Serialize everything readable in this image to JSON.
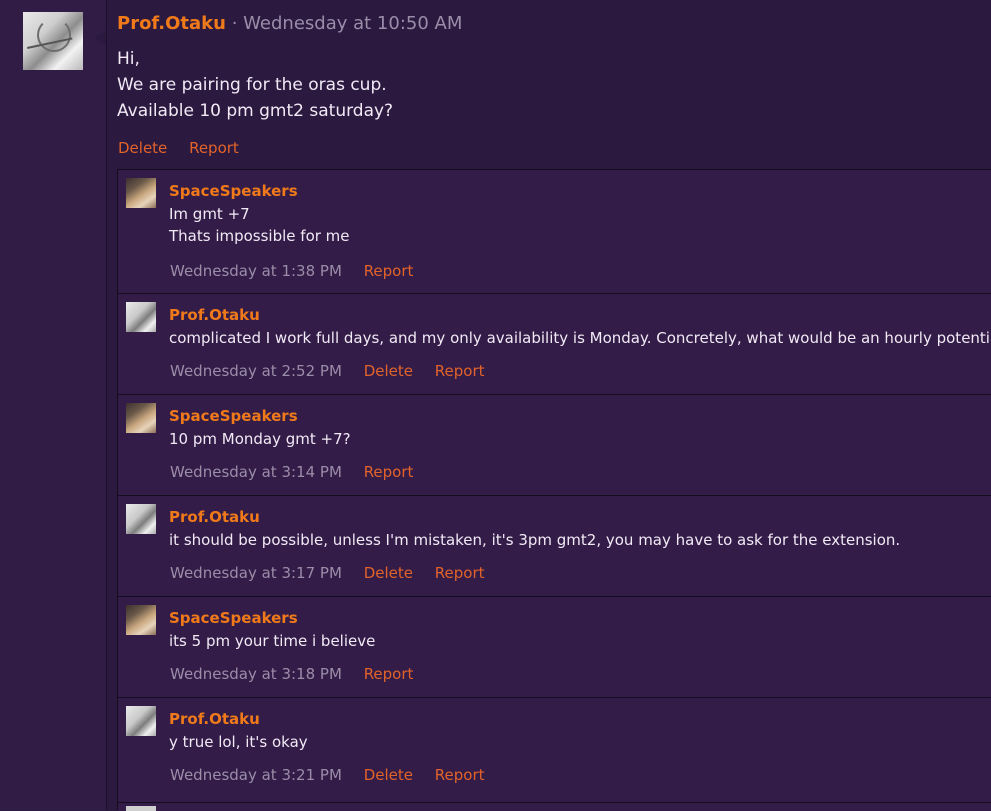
{
  "post": {
    "author": "Prof.Otaku",
    "separator": "·",
    "timestamp": "Wednesday at 10:50 AM",
    "lines": [
      "Hi,",
      "We are pairing for the oras cup.",
      "Available 10 pm gmt2 saturday?"
    ],
    "actions": {
      "delete": "Delete",
      "report": "Report"
    }
  },
  "comments": [
    {
      "author": "SpaceSpeakers",
      "avatar": "spacespeakers-avatar",
      "lines": [
        "Im gmt +7",
        "Thats impossible for me"
      ],
      "time": "Wednesday at 1:38 PM",
      "report": "Report"
    },
    {
      "author": "Prof.Otaku",
      "avatar": "prof-otaku-avatar",
      "lines": [
        "complicated I work full days, and my only availability is Monday. Concretely, what would be an hourly potential?"
      ],
      "time": "Wednesday at 2:52 PM",
      "delete": "Delete",
      "report": "Report"
    },
    {
      "author": "SpaceSpeakers",
      "avatar": "spacespeakers-avatar",
      "lines": [
        "10 pm Monday gmt +7?"
      ],
      "time": "Wednesday at 3:14 PM",
      "report": "Report"
    },
    {
      "author": "Prof.Otaku",
      "avatar": "prof-otaku-avatar",
      "lines": [
        "it should be possible, unless I'm mistaken, it's 3pm gmt2, you may have to ask for the extension."
      ],
      "time": "Wednesday at 3:17 PM",
      "delete": "Delete",
      "report": "Report"
    },
    {
      "author": "SpaceSpeakers",
      "avatar": "spacespeakers-avatar",
      "lines": [
        "its 5 pm your time i believe"
      ],
      "time": "Wednesday at 3:18 PM",
      "report": "Report"
    },
    {
      "author": "Prof.Otaku",
      "avatar": "prof-otaku-avatar",
      "lines": [
        "y true lol, it's okay"
      ],
      "time": "Wednesday at 3:21 PM",
      "delete": "Delete",
      "report": "Report"
    }
  ],
  "colors": {
    "background": "#2b1940",
    "comment_background": "#331c48",
    "author": "#f07a1a",
    "link": "#e2632a",
    "muted": "#9b8da8",
    "text": "#f1eaf5"
  }
}
